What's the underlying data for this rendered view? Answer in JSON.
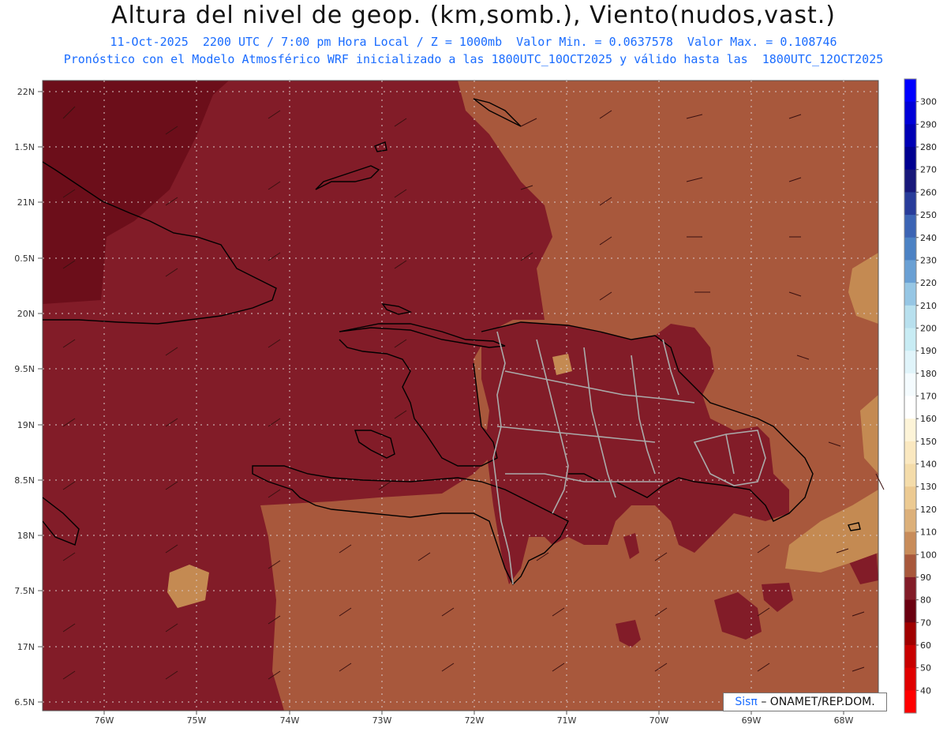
{
  "header": {
    "title": "Altura del nivel de geop. (km,somb.), Viento(nudos,vast.)",
    "subtitle_1": "11-Oct-2025  2200 UTC / 7:00 pm Hora Local / Z = 1000mb  Valor Min. = 0.0637578  Valor Max. = 0.108746",
    "subtitle_2": "Pronóstico con el Modelo Atmosférico WRF inicializado a las 1800UTC_10OCT2025 y válido hasta las  1800UTC_12OCT2025"
  },
  "axes": {
    "lat_labels": [
      "22N",
      "1.5N",
      "21N",
      "0.5N",
      "20N",
      "9.5N",
      "19N",
      "8.5N",
      "18N",
      "7.5N",
      "17N",
      "6.5N"
    ],
    "lon_labels": [
      "76W",
      "75W",
      "74W",
      "73W",
      "72W",
      "71W",
      "70W",
      "69W",
      "68W"
    ]
  },
  "colorbar": {
    "labels": [
      "300",
      "290",
      "280",
      "270",
      "260",
      "250",
      "240",
      "230",
      "220",
      "210",
      "200",
      "190",
      "180",
      "170",
      "160",
      "150",
      "140",
      "130",
      "120",
      "110",
      "100",
      "90",
      "80",
      "70",
      "60",
      "50",
      "40"
    ],
    "colors": [
      "#0000ff",
      "#0000d8",
      "#0000b4",
      "#000090",
      "#18187a",
      "#283c9a",
      "#3c64b4",
      "#4c82c4",
      "#6aa0d4",
      "#96c6e4",
      "#b8e0ee",
      "#c8ecf4",
      "#e0f4fa",
      "#f4fbfe",
      "#ffffff",
      "#fdf4d8",
      "#fae8c0",
      "#f4dcaa",
      "#ecca92",
      "#dcb07a",
      "#c88c5a",
      "#a8583c",
      "#821c28",
      "#6a0010",
      "#a00000",
      "#c80000",
      "#e00000",
      "#ff0000"
    ]
  },
  "field_colors": {
    "dark": "#6c0e1a",
    "mid": "#821c28",
    "brown": "#a8583c",
    "tan": "#c48a52"
  },
  "badge": {
    "logo": "Sisπ",
    "text": "– ONAMET/REP.DOM."
  }
}
